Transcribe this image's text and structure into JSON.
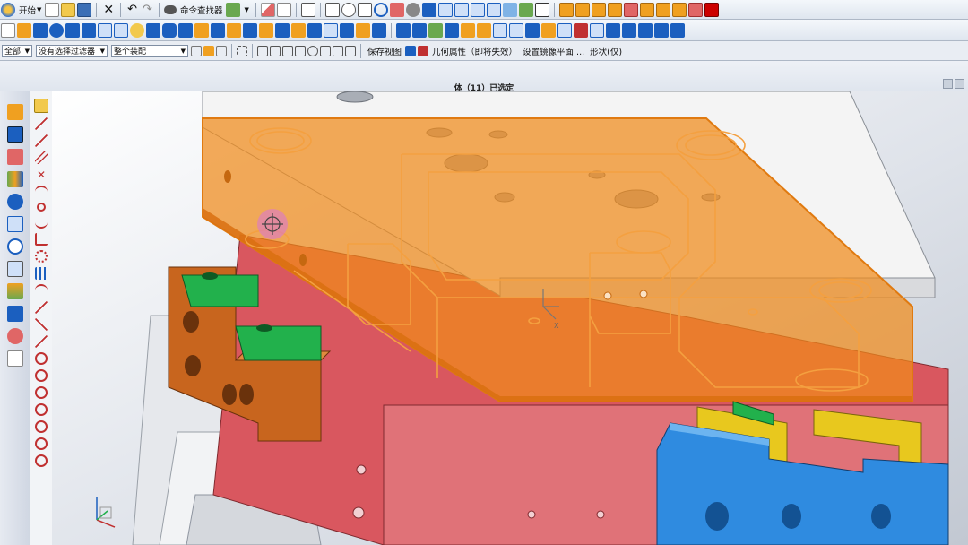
{
  "toolbar_top": {
    "start_label": "开始",
    "command_finder_label": "命令查找器"
  },
  "selection_bar": {
    "type_filter": "全部",
    "filter_placeholder": "没有选择过滤器",
    "assembly_scope": "整个装配",
    "save_view_label": "保存视图",
    "geometry_props_label": "几何属性（即将失效）",
    "mirror_plane_label": "设置镜像平面 ...",
    "shape_label": "形状(仅)"
  },
  "status": {
    "selection_text": "体（11）已选定"
  },
  "icons": {
    "primary": "#1b5fbf",
    "accent": "#f0a020",
    "sketch": "#c03030"
  },
  "model_colors": {
    "top_plate": "#eeeeee",
    "selected_plate": "#f08a1a",
    "cavity_block": "#d9575f",
    "side_block": "#c8651e",
    "green_part": "#22b14c",
    "yellow_part": "#e8c81e",
    "blue_part": "#2f8be0"
  }
}
